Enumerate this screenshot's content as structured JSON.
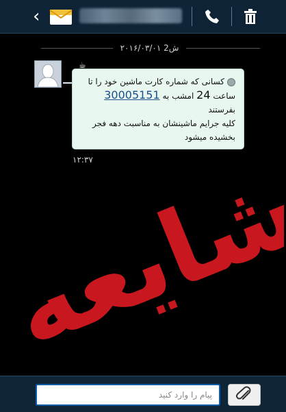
{
  "header": {
    "back_icon": "chevron-left-icon",
    "contact_icon": "envelope-icon",
    "contact_name_blurred": true,
    "call_icon": "phone-icon",
    "delete_icon": "trash-icon"
  },
  "conversation": {
    "date_label": "۲۰۱۶/۰۳/۰۱ ش2",
    "message": {
      "line1": "کسانی که شماره کارت ماشین خود را تا",
      "line2_pre": "ساعت",
      "line2_num": "24",
      "line2_mid": "امشب به",
      "line2_link": "30005151",
      "line2_post": "بفرستند",
      "line3": "کلیه جرایم ماشینشان به مناسبت دهه فجر",
      "line4": "بخشیده میشود",
      "time": "۱۲:۳۷"
    }
  },
  "overlay": {
    "stamp_text": "شایعه",
    "stamp_color": "#c8171e"
  },
  "composer": {
    "placeholder": "پیام را وارد کنید",
    "attach_icon": "paperclip-icon"
  }
}
